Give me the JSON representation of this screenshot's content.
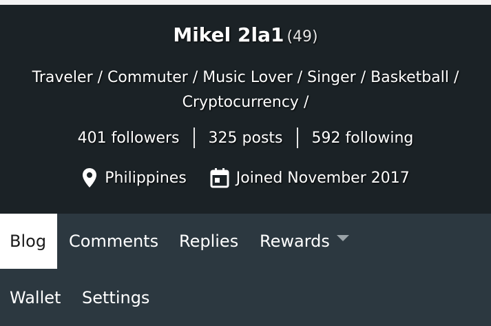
{
  "profile": {
    "name": "Mikel 2la1",
    "reputation": "(49)",
    "bio_line1": "Traveler / Commuter / Music Lover / Singer / Basketball /",
    "bio_line2": "Cryptocurrency /",
    "followers": "401 followers",
    "posts": "325 posts",
    "following": "592 following",
    "location": "Philippines",
    "joined": "Joined November 2017"
  },
  "nav": {
    "tabs": [
      {
        "label": "Blog",
        "active": true
      },
      {
        "label": "Comments"
      },
      {
        "label": "Replies"
      },
      {
        "label": "Rewards",
        "has_dropdown": true
      },
      {
        "label": "Wallet"
      },
      {
        "label": "Settings"
      }
    ]
  },
  "colors": {
    "header_bg": "#1b2226",
    "nav_bg": "#2c3840",
    "active_tab_bg": "#ffffff"
  },
  "icons": {
    "location": "map-pin-icon",
    "joined": "calendar-icon",
    "rewards_dropdown": "caret-down-icon"
  }
}
